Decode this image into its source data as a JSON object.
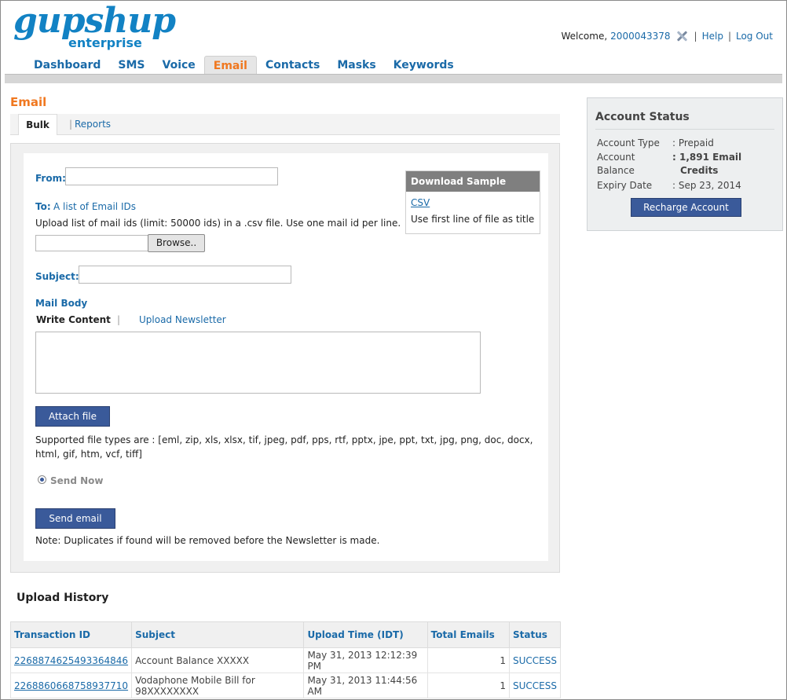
{
  "brand": {
    "logo_main": "gupshup",
    "logo_sub": "enterprise"
  },
  "user": {
    "welcome": "Welcome,",
    "id": "2000043378",
    "help": "Help",
    "logout": "Log Out"
  },
  "nav": [
    "Dashboard",
    "SMS",
    "Voice",
    "Email",
    "Contacts",
    "Masks",
    "Keywords"
  ],
  "nav_active": "Email",
  "page": {
    "title": "Email",
    "tab_active": "Bulk",
    "tab_other": "Reports"
  },
  "form": {
    "from_label": "From:",
    "to_label": "To:",
    "to_link": "A list of Email IDs",
    "to_help": "Upload list of mail ids (limit: 50000 ids) in a .csv file. Use one mail id per line.",
    "browse": "Browse..",
    "subject_label": "Subject:",
    "mail_body_label": "Mail Body",
    "write_content": "Write Content",
    "upload_newsletter": "Upload Newsletter",
    "attach_file": "Attach file",
    "supported_types": "Supported file types are : [eml, zip, xls, xlsx, tif, jpeg, pdf, pps, rtf, pptx, jpe, ppt, txt, jpg, png, doc, docx, html, gif, htm, vcf, tiff]",
    "send_now": "Send Now",
    "send_email": "Send email",
    "note": "Note: Duplicates if found will be removed before the Newsletter is made."
  },
  "download_sample": {
    "title": "Download Sample",
    "link": "CSV",
    "note": "Use first line of file as title"
  },
  "account_status": {
    "title": "Account Status",
    "type_label": "Account Type",
    "type_value": ": Prepaid",
    "balance_label_1": "Account",
    "balance_label_2": "Balance",
    "balance_value_1": ": 1,891 Email",
    "balance_value_2": "Credits",
    "expiry_label": "Expiry Date",
    "expiry_value": ": Sep 23, 2014",
    "recharge": "Recharge Account"
  },
  "history": {
    "title": "Upload History",
    "columns": [
      "Transaction ID",
      "Subject",
      "Upload Time (IDT)",
      "Total Emails",
      "Status"
    ],
    "rows": [
      {
        "id": "2268874625493364846",
        "subject": "Account Balance XXXXX",
        "time": "May 31, 2013 12:12:39 PM",
        "total": "1",
        "status": "SUCCESS"
      },
      {
        "id": "2268860668758937710",
        "subject": "Vodaphone Mobile Bill for 98XXXXXXXX",
        "time": "May 31, 2013 11:44:56 AM",
        "total": "1",
        "status": "SUCCESS"
      }
    ]
  },
  "colors": {
    "brand_blue": "#1282c4",
    "accent_orange": "#f07820",
    "button_blue": "#3a5a9a",
    "link_blue": "#1a6aa8"
  }
}
